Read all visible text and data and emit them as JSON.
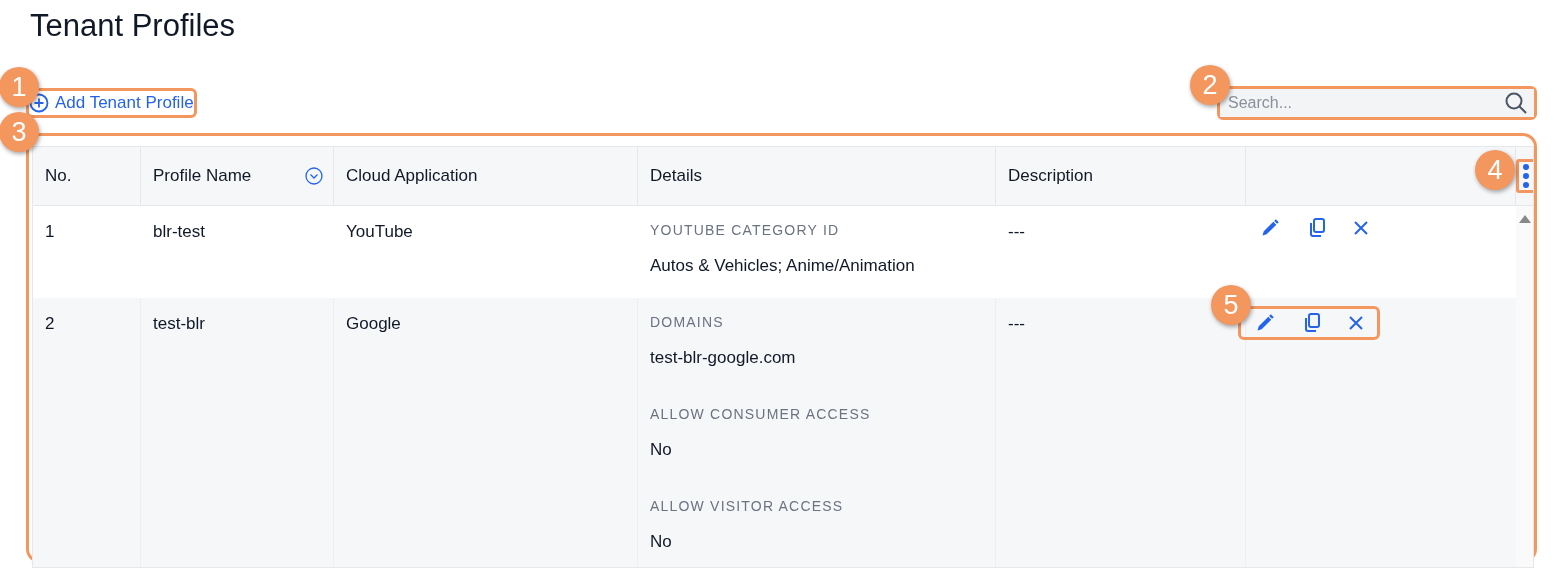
{
  "title": "Tenant Profiles",
  "add_button": {
    "label": "Add Tenant Profile",
    "callout": "1"
  },
  "search": {
    "placeholder": "Search...",
    "callout": "2"
  },
  "table": {
    "callout": "3",
    "columns": [
      {
        "label": "No.",
        "sortable": false
      },
      {
        "label": "Profile Name",
        "sortable": true
      },
      {
        "label": "Cloud Application",
        "sortable": false
      },
      {
        "label": "Details",
        "sortable": false
      },
      {
        "label": "Description",
        "sortable": false
      }
    ],
    "menu_callout": "4",
    "rows": [
      {
        "no": "1",
        "name": "blr-test",
        "app": "YouTube",
        "details": [
          {
            "label": "YOUTUBE CATEGORY ID",
            "value": "Autos & Vehicles; Anime/Animation"
          }
        ],
        "description": "---",
        "striped": false
      },
      {
        "no": "2",
        "name": "test-blr",
        "app": "Google",
        "details": [
          {
            "label": "DOMAINS",
            "value": "test-blr-google.com"
          },
          {
            "label": "ALLOW CONSUMER ACCESS",
            "value": "No"
          },
          {
            "label": "ALLOW VISITOR ACCESS",
            "value": "No"
          }
        ],
        "description": "---",
        "striped": true,
        "actions_callout": "5"
      }
    ]
  }
}
